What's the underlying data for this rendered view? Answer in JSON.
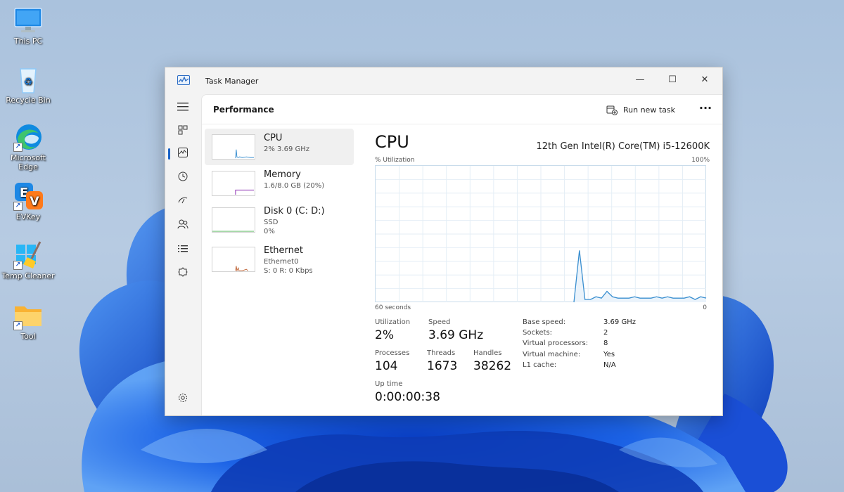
{
  "desktop": {
    "icons": [
      {
        "label": "This PC"
      },
      {
        "label": "Recycle Bin"
      },
      {
        "label": "Microsoft Edge"
      },
      {
        "label": "EVKey"
      },
      {
        "label": "Temp Cleaner"
      },
      {
        "label": "Tool"
      }
    ]
  },
  "window": {
    "title": "Task Manager",
    "minimize": "—",
    "maximize": "☐",
    "close": "✕"
  },
  "header": {
    "page_title": "Performance",
    "run_new_task": "Run new task",
    "more": "···"
  },
  "perf_list": [
    {
      "name": "CPU",
      "sub1": "2% 3.69 GHz",
      "sub2": ""
    },
    {
      "name": "Memory",
      "sub1": "1.6/8.0 GB (20%)",
      "sub2": ""
    },
    {
      "name": "Disk 0 (C: D:)",
      "sub1": "SSD",
      "sub2": "0%"
    },
    {
      "name": "Ethernet",
      "sub1": "Ethernet0",
      "sub2": "S: 0 R: 0 Kbps"
    }
  ],
  "detail": {
    "title": "CPU",
    "model": "12th Gen Intel(R) Core(TM) i5-12600K",
    "util_label": "% Utilization",
    "max_label": "100%",
    "time_label": "60 seconds",
    "zero_label": "0",
    "stats": {
      "utilization_label": "Utilization",
      "utilization": "2%",
      "speed_label": "Speed",
      "speed": "3.69 GHz",
      "processes_label": "Processes",
      "processes": "104",
      "threads_label": "Threads",
      "threads": "1673",
      "handles_label": "Handles",
      "handles": "38262",
      "uptime_label": "Up time",
      "uptime": "0:00:00:38"
    },
    "specs": [
      {
        "key": "Base speed:",
        "value": "3.69 GHz"
      },
      {
        "key": "Sockets:",
        "value": "2"
      },
      {
        "key": "Virtual processors:",
        "value": "8"
      },
      {
        "key": "Virtual machine:",
        "value": "Yes"
      },
      {
        "key": "L1 cache:",
        "value": "N/A"
      }
    ],
    "cpu_history": [
      0,
      0,
      0,
      0,
      0,
      0,
      0,
      0,
      0,
      0,
      0,
      0,
      0,
      0,
      0,
      0,
      0,
      0,
      0,
      0,
      0,
      0,
      0,
      0,
      0,
      0,
      0,
      0,
      0,
      0,
      0,
      0,
      0,
      0,
      0,
      0,
      0,
      38,
      2,
      2,
      4,
      3,
      8,
      4,
      3,
      3,
      3,
      4,
      3,
      3,
      3,
      4,
      3,
      4,
      3,
      3,
      3,
      4,
      2,
      4,
      3
    ]
  },
  "colors": {
    "accent": "#1a63c7",
    "cpu_line": "#3a8fd0",
    "cpu_fill": "#eaf3fb",
    "memory_line": "#9b4bbd"
  }
}
